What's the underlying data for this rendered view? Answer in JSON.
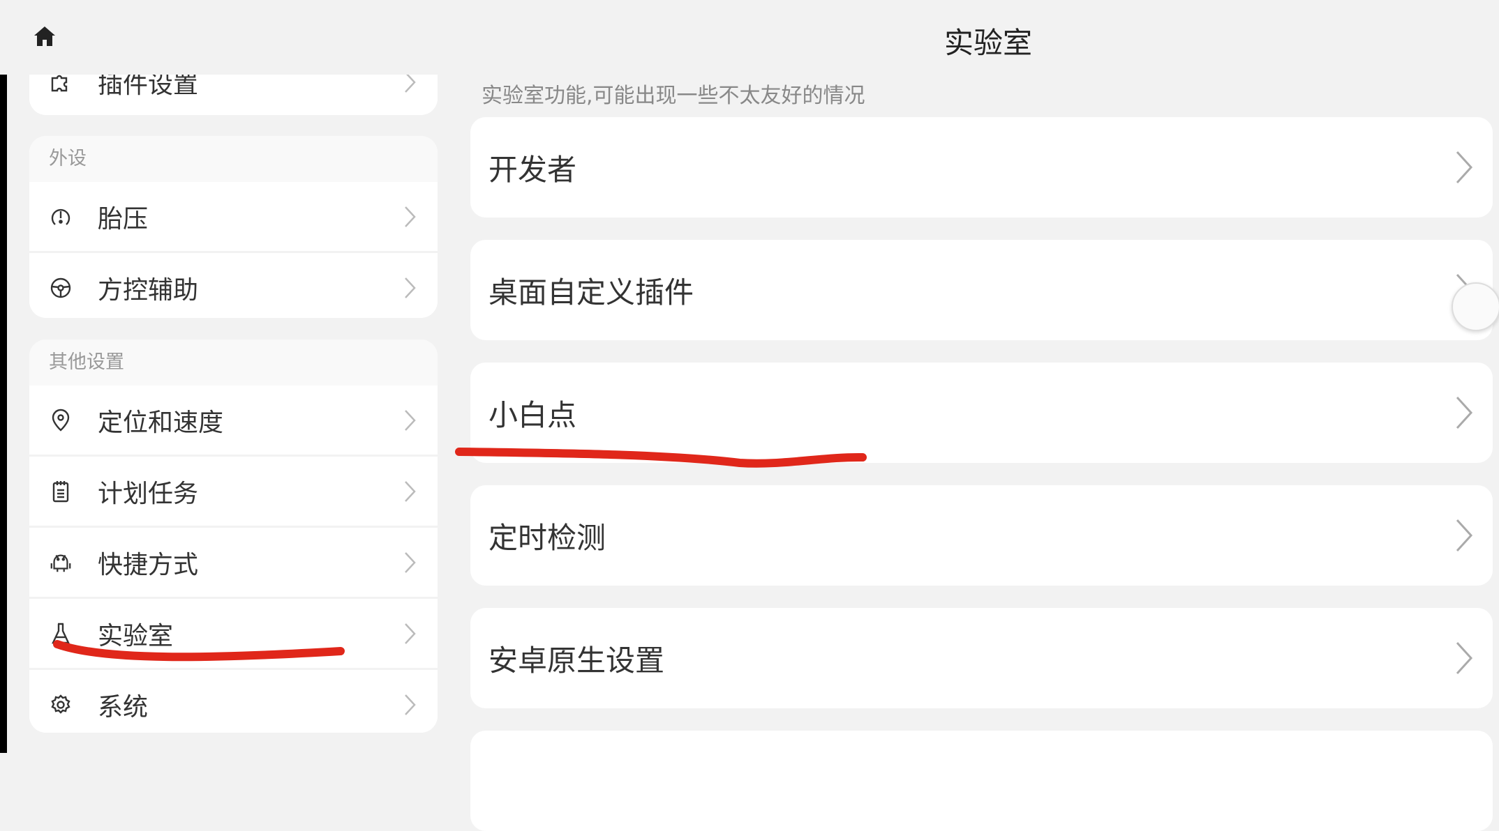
{
  "header": {
    "title": "实验室"
  },
  "sidebar": {
    "top_item": {
      "label": "插件设置",
      "icon": "puzzle-icon"
    },
    "groups": [
      {
        "label": "外设",
        "items": [
          {
            "label": "胎压",
            "icon": "tire-pressure-icon"
          },
          {
            "label": "方控辅助",
            "icon": "steering-wheel-icon"
          }
        ]
      },
      {
        "label": "其他设置",
        "items": [
          {
            "label": "定位和速度",
            "icon": "location-pin-icon"
          },
          {
            "label": "计划任务",
            "icon": "notepad-icon"
          },
          {
            "label": "快捷方式",
            "icon": "android-icon"
          },
          {
            "label": "实验室",
            "icon": "flask-icon"
          },
          {
            "label": "系统",
            "icon": "gear-icon"
          }
        ]
      }
    ]
  },
  "main": {
    "subtitle": "实验室功能,可能出现一些不太友好的情况",
    "items": [
      {
        "label": "开发者"
      },
      {
        "label": "桌面自定义插件"
      },
      {
        "label": "小白点"
      },
      {
        "label": "定时检测"
      },
      {
        "label": "安卓原生设置"
      }
    ]
  },
  "colors": {
    "annotation": "#e0271a",
    "background": "#f2f2f2",
    "card": "#ffffff"
  }
}
